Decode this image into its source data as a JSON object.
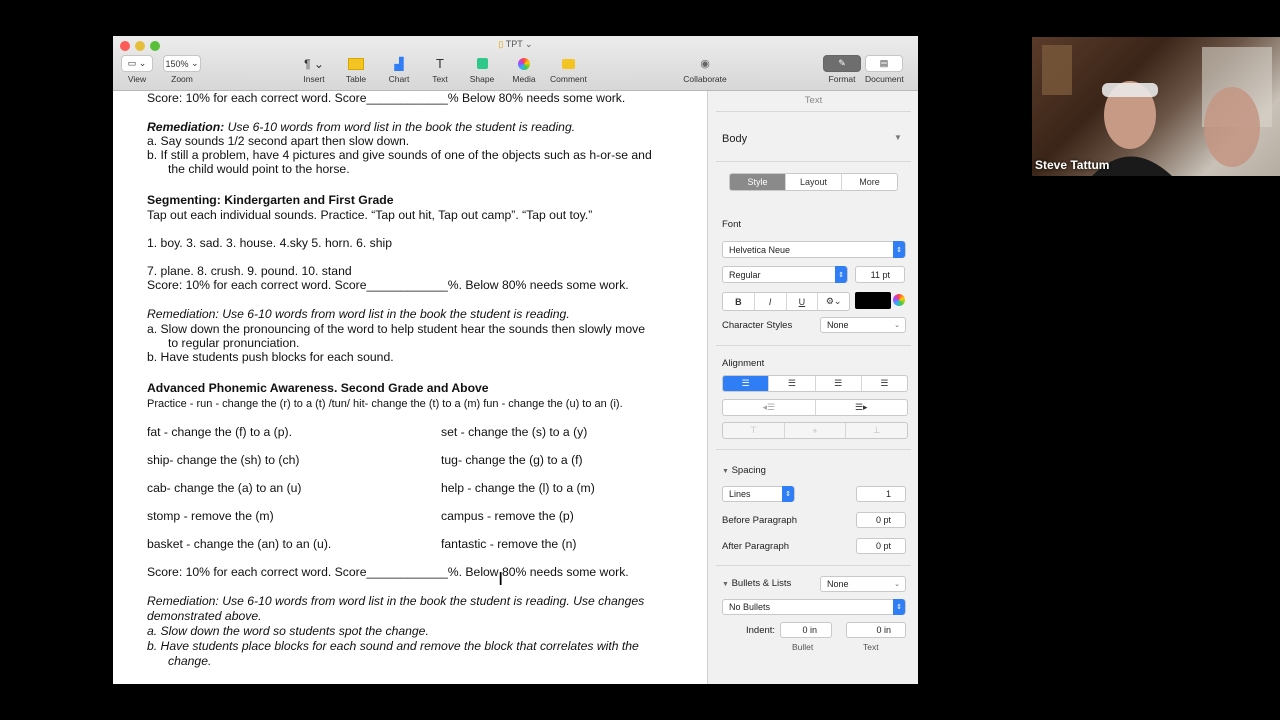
{
  "window": {
    "title": "TPT",
    "toolbar": {
      "view": "View",
      "zoom_value": "150%",
      "zoom": "Zoom",
      "insert": "Insert",
      "table": "Table",
      "chart": "Chart",
      "text": "Text",
      "shape": "Shape",
      "media": "Media",
      "comment": "Comment",
      "collaborate": "Collaborate",
      "format": "Format",
      "document": "Document"
    }
  },
  "doc": {
    "l1": "Score: 10% for each correct word.  Score____________% Below 80% needs some work.",
    "rem1_label": "Remediation:",
    "rem1_text": " Use 6-10 words from word list in the book the student is reading.",
    "rem1_a": "a.   Say sounds 1/2 second apart then slow down.",
    "rem1_b1": "b.   If still a problem, have 4 pictures and give sounds of one of the objects such as h-or-se and",
    "rem1_b2": "the child would point to the horse.",
    "seg_title": "Segmenting: Kindergarten and First Grade",
    "seg_practice": " Tap out each individual sounds.  Practice. “Tap out hit, Tap out camp”. “Tap out toy.”",
    "seg_list1": "1.   boy.  3.  sad.    3. house.    4.sky           5. horn.    6. ship",
    "seg_list2": "7. plane.    8. crush.   9.  pound.   10. stand",
    "seg_score": "Score: 10% for each correct word.  Score____________%. Below 80% needs some work.",
    "rem2": "Remediation: Use 6-10 words from word list in the book the student is reading.",
    "rem2_a1": "a.   Slow down the pronouncing of the word to help student hear the sounds then slowly move",
    "rem2_a2": "to regular pronunciation.",
    "rem2_b": "b.   Have students push blocks for each sound.",
    "adv_title": "Advanced Phonemic Awareness.  Second Grade and Above",
    "adv_practice": "Practice - run - change the (r) to a (t) /tun/   hit- change the (t) to a (m)   fun - change the (u) to an (i).",
    "left_items": [
      "fat - change the (f) to a (p).",
      "ship- change the (sh) to (ch)",
      "cab- change the (a) to an (u)",
      "stomp - remove the (m)",
      "basket - change the (an) to an (u)."
    ],
    "right_items": [
      "set - change the (s) to a (y)",
      "tug- change the (g) to a (f)",
      "help - change the (l)  to a (m)",
      "campus -  remove the (p)",
      "fantastic - remove the (n)"
    ],
    "adv_score": "Score: 10% for each correct word.  Score____________%. Below 80% needs some work.",
    "rem3_1": "Remediation: Use 6-10 words from word list in the book the student is reading. Use changes",
    "rem3_2": "demonstrated above.",
    "rem3_a": "a.   Slow down the word so students spot the change.",
    "rem3_b1": "b.   Have students place blocks for each sound and remove the block that correlates with the",
    "rem3_b2": "change."
  },
  "inspector": {
    "header": "Text",
    "para_style": "Body",
    "tabs": [
      "Style",
      "Layout",
      "More"
    ],
    "font_label": "Font",
    "font_name": "Helvetica Neue",
    "font_weight": "Regular",
    "font_size": "11 pt",
    "char_styles_label": "Character Styles",
    "char_styles_value": "None",
    "alignment_label": "Alignment",
    "spacing_label": "Spacing",
    "spacing_mode": "Lines",
    "spacing_value": "1",
    "before_para_label": "Before Paragraph",
    "before_para_value": "0 pt",
    "after_para_label": "After Paragraph",
    "after_para_value": "0 pt",
    "bullets_label": "Bullets & Lists",
    "bullets_value": "None",
    "bullet_style": "No Bullets",
    "indent_label": "Indent:",
    "indent_bullet": "0 in",
    "indent_text": "0 in",
    "bullet_caption": "Bullet",
    "text_caption": "Text",
    "text_color": "#000000"
  },
  "webcam": {
    "name": "Steve Tattum"
  }
}
